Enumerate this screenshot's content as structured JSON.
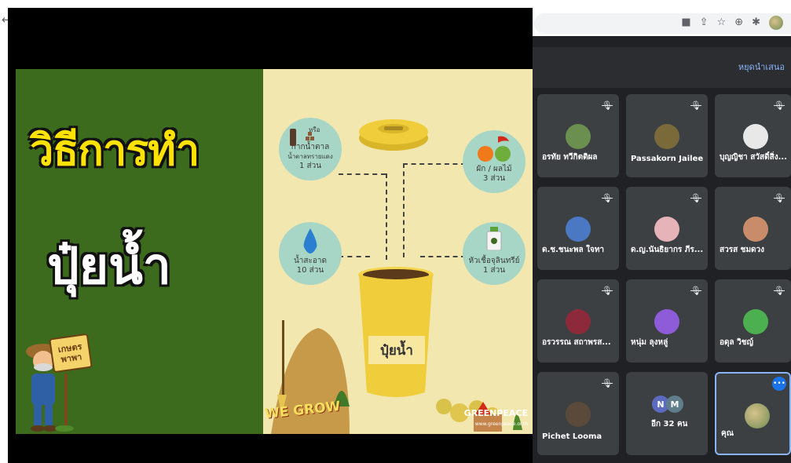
{
  "colors": {
    "slide_green": "#3c6b1e",
    "slide_cream": "#f3e7b0",
    "title_yellow": "#ffe200",
    "panel_bg": "#202124",
    "tile_bg": "#3c4043",
    "accent_blue": "#8ab4f8"
  },
  "browser": {
    "icons": [
      "back-arrow-icon",
      "camera-icon",
      "share-icon",
      "star-icon",
      "extension-icon",
      "puzzle-icon",
      "profile-avatar"
    ]
  },
  "slide": {
    "title_line1": "วิธีการทำ",
    "title_line2": "ปุ๋ยน้ำ",
    "sign_line1": "เกษตร",
    "sign_line2": "พาพา",
    "ingredients": {
      "sugar": {
        "or": "หรือ",
        "line1": "กากน้ำตาล",
        "line2": "น้ำตาลทรายแดง",
        "line3": "1 ส่วน"
      },
      "veg": {
        "line1": "ผัก / ผลไม้",
        "line2": "3 ส่วน"
      },
      "water": {
        "line1": "น้ำสะอาด",
        "line2": "10 ส่วน"
      },
      "starter": {
        "line1": "หัวเชื้อจุลินทรีย์",
        "line2": "1 ส่วน"
      }
    },
    "bucket_label": "ปุ๋ยน้ำ",
    "brand_left": "WE GROW",
    "brand_right": "GREENPEACE",
    "brand_url": "www.greenpeace.or.th"
  },
  "meet": {
    "stop_presenting": "หยุดนำเสนอ",
    "participants": [
      {
        "name": "อรทัย ทวีกิตติผล",
        "muted": true,
        "avatar_color": "#6b8f4e"
      },
      {
        "name": "Passakorn Jailee",
        "muted": true,
        "avatar_color": "#7a6a3a"
      },
      {
        "name": "บุญญิชา สวัสดิ์สิ่ง...",
        "muted": true,
        "avatar_color": "#e8e8e8"
      },
      {
        "name": "ด.ช.ชนะพล ใจทา",
        "muted": true,
        "avatar_color": "#4a78c2"
      },
      {
        "name": "ด.ญ.นันธิยากร ภีร...",
        "muted": true,
        "avatar_color": "#e6b3b8"
      },
      {
        "name": "สวรส ชมดวง",
        "muted": true,
        "avatar_color": "#c98c6a"
      },
      {
        "name": "อรวรรณ สถาพรส...",
        "muted": true,
        "avatar_color": "#8c2a3c"
      },
      {
        "name": "หนุ่ม ลุงหลู่",
        "muted": true,
        "avatar_color": "#8e5cd9"
      },
      {
        "name": "อดุล วิชญ์",
        "muted": true,
        "avatar_color": "#4caf50"
      },
      {
        "name": "Pichet Looma",
        "muted": true,
        "avatar_color": "#5a4a3a"
      }
    ],
    "others": {
      "label": "อีก 32 คน",
      "badge1": "N",
      "badge2": "M"
    },
    "self": {
      "name": "คุณ",
      "more": "•••"
    }
  }
}
